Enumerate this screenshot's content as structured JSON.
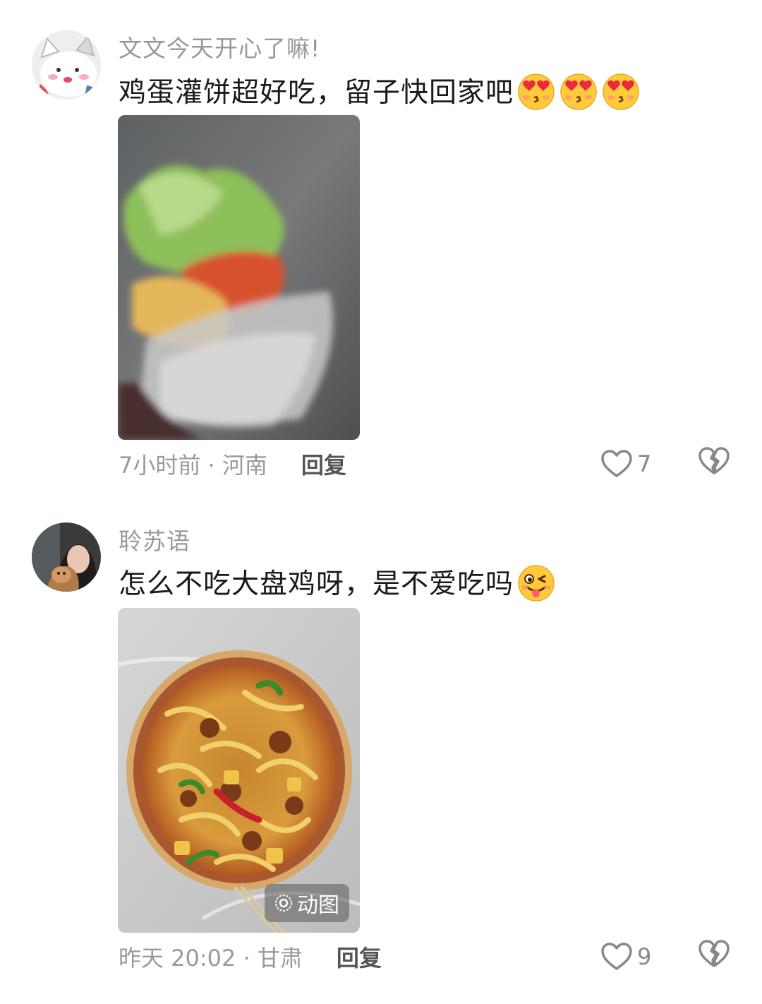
{
  "comments": [
    {
      "username": "文文今天开心了嘛!",
      "text": "鸡蛋灌饼超好吃，留子快回家吧",
      "emojis": [
        "heart-eyes-kiss-emoji",
        "heart-eyes-kiss-emoji",
        "heart-eyes-kiss-emoji"
      ],
      "image": "egg-pancake-photo",
      "meta": "7小时前 · 河南",
      "reply_label": "回复",
      "likes": "7"
    },
    {
      "username": "聆苏语",
      "text": "怎么不吃大盘鸡呀，是不爱吃吗",
      "emojis": [
        "wink-tongue-emoji"
      ],
      "image": "big-plate-chicken-photo",
      "gif_label": "动图",
      "meta": "昨天 20:02 · 甘肃",
      "reply_label": "回复",
      "likes": "9"
    }
  ],
  "colors": {
    "username": "#999999",
    "text": "#1a1a1a",
    "meta": "#9a9a9a",
    "reply": "#555555",
    "icon": "#888888"
  }
}
